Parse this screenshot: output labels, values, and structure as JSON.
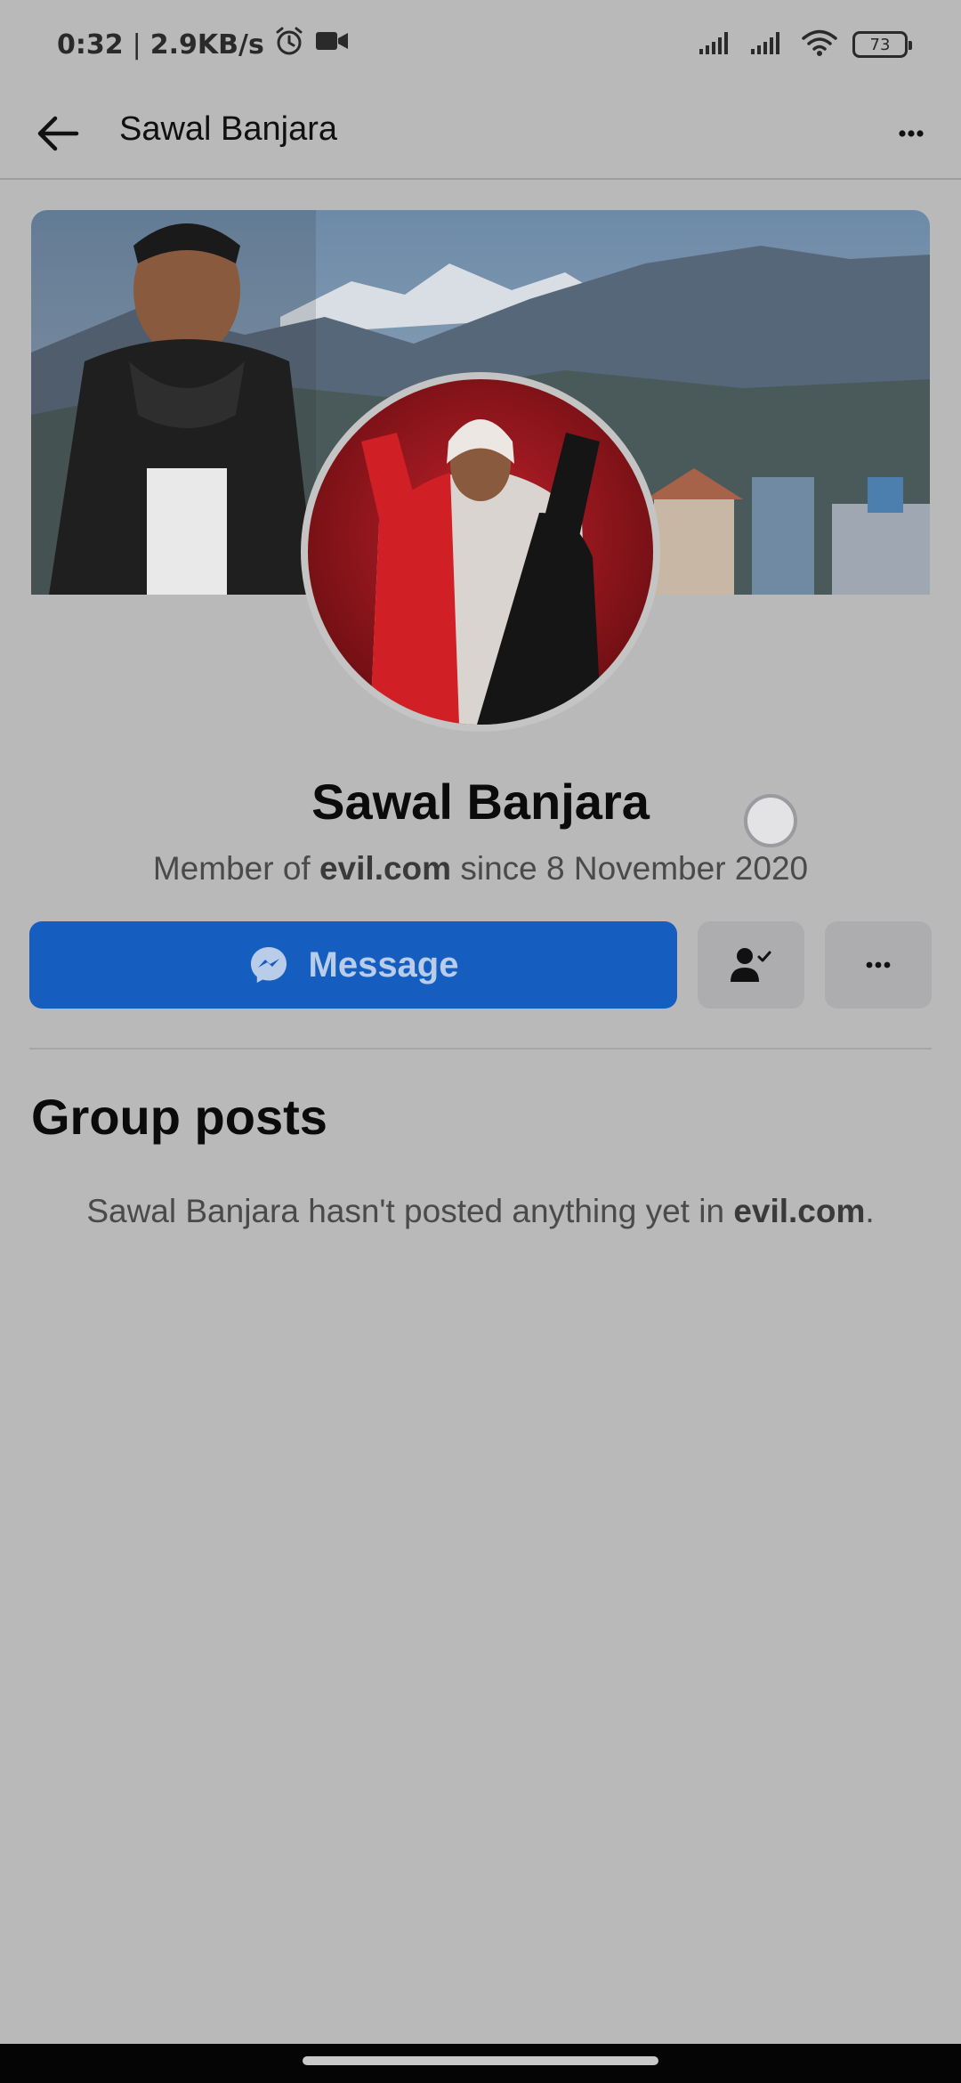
{
  "status_bar": {
    "time": "0:32",
    "separator": "|",
    "network_speed": "2.9KB/s",
    "battery_level": "73",
    "icons": [
      "alarm-icon",
      "video-camera-icon",
      "signal-icon",
      "signal-icon",
      "wifi-icon",
      "battery-icon"
    ]
  },
  "app_bar": {
    "title": "Sawal Banjara",
    "back_icon": "arrow-left-icon",
    "menu_icon": "more-horizontal-icon"
  },
  "profile": {
    "name": "Sawal Banjara",
    "member_prefix": "Member of ",
    "group_name": "evil.com",
    "member_suffix": " since 8 November 2020"
  },
  "actions": {
    "message_label": "Message",
    "message_icon": "messenger-icon",
    "friends_icon": "person-check-icon",
    "more_icon": "more-horizontal-icon"
  },
  "group_posts": {
    "title": "Group posts",
    "empty_prefix": "Sawal Banjara hasn't posted anything yet in ",
    "empty_group": "evil.com",
    "empty_suffix": "."
  },
  "colors": {
    "background": "#b9b9b9",
    "message_button": "#155ec0",
    "secondary_button": "#adadaf"
  }
}
